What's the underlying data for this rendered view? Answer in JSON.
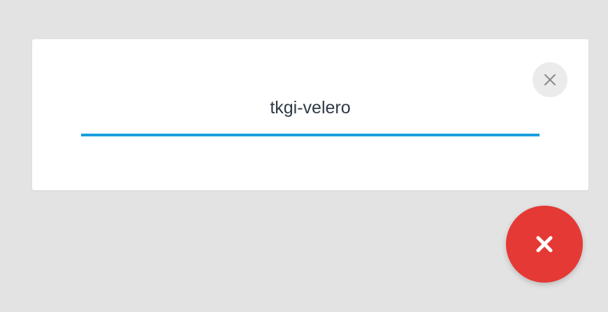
{
  "search": {
    "value": "tkgi-velero",
    "placeholder": ""
  },
  "icons": {
    "clear": "close-icon",
    "fab": "close-icon"
  },
  "colors": {
    "background": "#e3e3e3",
    "card": "#ffffff",
    "underline": "#1a9fe0",
    "fab": "#e53935",
    "clear_button": "#ebebeb",
    "text": "#2f3a45"
  }
}
